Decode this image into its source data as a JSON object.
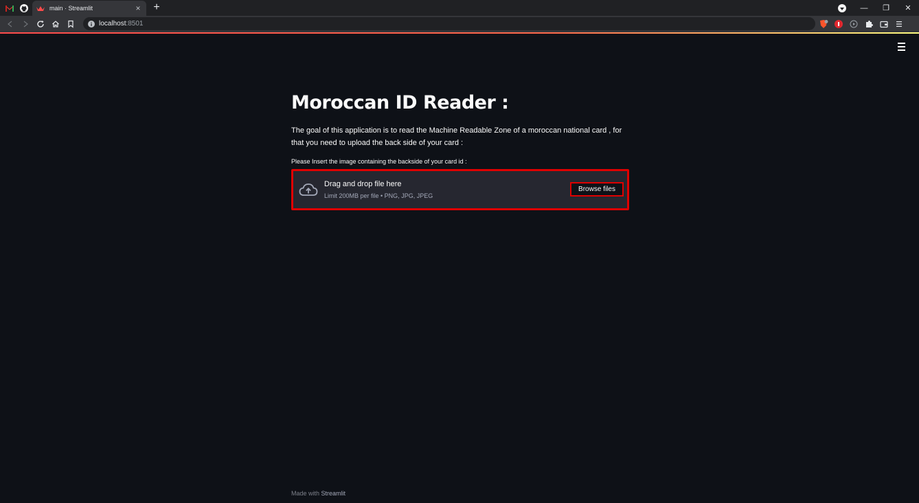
{
  "browser": {
    "tab_title": "main · Streamlit",
    "tab_close": "×",
    "new_tab": "+",
    "url_host": "localhost",
    "url_port": ":8501",
    "window_minimize": "—",
    "window_restore": "❐",
    "window_close": "✕"
  },
  "page": {
    "title": "Moroccan ID Reader :",
    "description": "The goal of this application is to read the Machine Readable Zone of a moroccan national card , for that you need to upload the back side of your card :",
    "uploader": {
      "label": "Please Insert the image containing the backside of your card id :",
      "drop_text": "Drag and drop file here",
      "limit_text": "Limit 200MB per file • PNG, JPG, JPEG",
      "browse_label": "Browse files"
    },
    "footer": {
      "made_with": "Made with ",
      "brand": "Streamlit"
    }
  },
  "colors": {
    "background": "#0e1117",
    "dropzone_bg": "#262730",
    "highlight": "#e00000",
    "text": "#fafafa"
  },
  "icons": [
    "gmail-icon",
    "github-icon",
    "streamlit-icon",
    "back-icon",
    "forward-icon",
    "reload-icon",
    "home-icon",
    "bookmark-icon",
    "info-icon",
    "brave-shield-icon",
    "extension-icon",
    "puzzle-icon",
    "wallet-icon",
    "menu-icon",
    "cloud-upload-icon"
  ]
}
